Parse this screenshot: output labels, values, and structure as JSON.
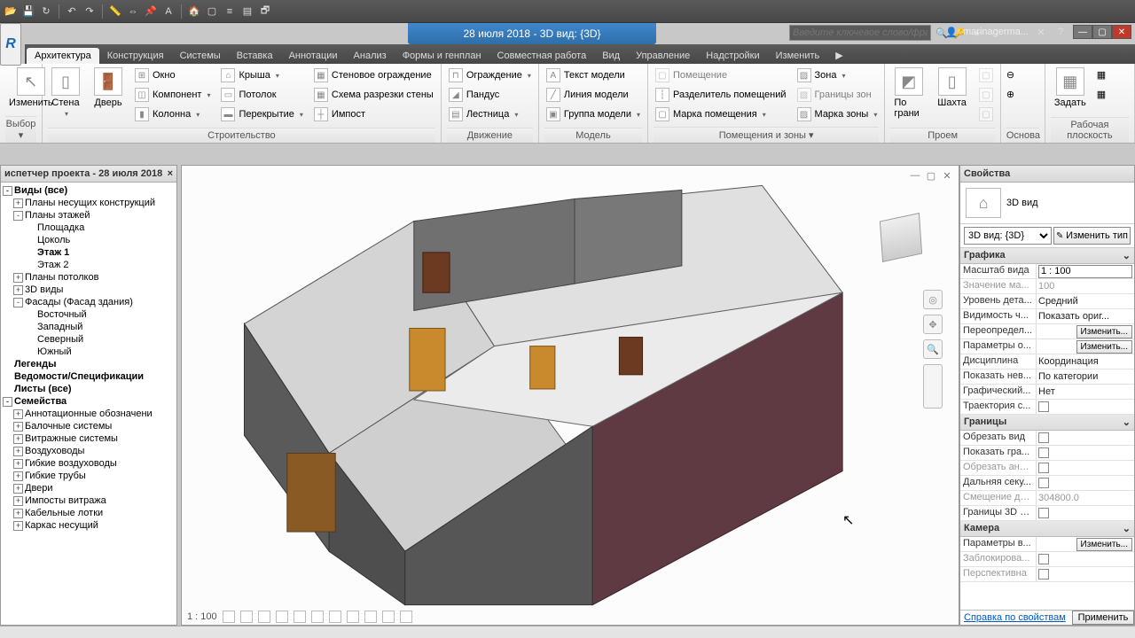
{
  "title": "28 июля 2018 - 3D вид: {3D}",
  "search_placeholder": "Введите ключевое слово/фразу",
  "user": "marinagerma...",
  "tabs": [
    "Архитектура",
    "Конструкция",
    "Системы",
    "Вставка",
    "Аннотации",
    "Анализ",
    "Формы и генплан",
    "Совместная работа",
    "Вид",
    "Управление",
    "Надстройки",
    "Изменить"
  ],
  "active_tab": 0,
  "ribbon": {
    "select": {
      "modify": "Изменить",
      "group": "Выбор"
    },
    "build": {
      "wall": "Стена",
      "door": "Дверь",
      "window": "Окно",
      "component": "Компонент",
      "column": "Колонна",
      "roof": "Крыша",
      "ceiling": "Потолок",
      "floor": "Перекрытие",
      "curtain_wall": "Стеновое ограждение",
      "curtain_grid": "Схема разрезки стены",
      "mullion": "Импост",
      "group": "Строительство"
    },
    "circ": {
      "rail": "Ограждение",
      "ramp": "Пандус",
      "stair": "Лестница",
      "group": "Движение"
    },
    "model": {
      "text": "Текст модели",
      "line": "Линия модели",
      "grp": "Группа модели",
      "group": "Модель"
    },
    "rooms": {
      "room": "Помещение",
      "room_sep": "Разделитель помещений",
      "room_tag": "Марка помещения",
      "area": "Зона",
      "area_bound": "Границы зон",
      "area_tag": "Марка зоны",
      "group": "Помещения и зоны"
    },
    "opening": {
      "face": "По грани",
      "shaft": "Шахта",
      "group": "Проем"
    },
    "datum": {
      "grid": "",
      "group": "Основа"
    },
    "work": {
      "set": "Задать",
      "group": "Рабочая плоскость"
    }
  },
  "browser": {
    "title": "испетчер проекта - 28 июля 2018",
    "nodes": [
      {
        "lvl": 0,
        "pm": "-",
        "bold": true,
        "label": "Виды (все)"
      },
      {
        "lvl": 1,
        "pm": "+",
        "label": "Планы несущих конструкций"
      },
      {
        "lvl": 1,
        "pm": "-",
        "label": "Планы этажей"
      },
      {
        "lvl": 2,
        "label": "Площадка"
      },
      {
        "lvl": 2,
        "label": "Цоколь"
      },
      {
        "lvl": 2,
        "bold": true,
        "label": "Этаж 1"
      },
      {
        "lvl": 2,
        "label": "Этаж 2"
      },
      {
        "lvl": 1,
        "pm": "+",
        "label": "Планы потолков"
      },
      {
        "lvl": 1,
        "pm": "+",
        "label": "3D виды"
      },
      {
        "lvl": 1,
        "pm": "-",
        "label": "Фасады (Фасад здания)"
      },
      {
        "lvl": 2,
        "label": "Восточный"
      },
      {
        "lvl": 2,
        "label": "Западный"
      },
      {
        "lvl": 2,
        "label": "Северный"
      },
      {
        "lvl": 2,
        "label": "Южный"
      },
      {
        "lvl": 0,
        "bold": true,
        "label": "Легенды"
      },
      {
        "lvl": 0,
        "bold": true,
        "label": "Ведомости/Спецификации"
      },
      {
        "lvl": 0,
        "bold": true,
        "label": "Листы (все)"
      },
      {
        "lvl": 0,
        "pm": "-",
        "bold": true,
        "label": "Семейства"
      },
      {
        "lvl": 1,
        "pm": "+",
        "label": "Аннотационные обозначени"
      },
      {
        "lvl": 1,
        "pm": "+",
        "label": "Балочные системы"
      },
      {
        "lvl": 1,
        "pm": "+",
        "label": "Витражные системы"
      },
      {
        "lvl": 1,
        "pm": "+",
        "label": "Воздуховоды"
      },
      {
        "lvl": 1,
        "pm": "+",
        "label": "Гибкие воздуховоды"
      },
      {
        "lvl": 1,
        "pm": "+",
        "label": "Гибкие трубы"
      },
      {
        "lvl": 1,
        "pm": "+",
        "label": "Двери"
      },
      {
        "lvl": 1,
        "pm": "+",
        "label": "Импосты витража"
      },
      {
        "lvl": 1,
        "pm": "+",
        "label": "Кабельные лотки"
      },
      {
        "lvl": 1,
        "pm": "+",
        "label": "Каркас несущий"
      }
    ]
  },
  "view_scale": "1 : 100",
  "props": {
    "title": "Свойства",
    "type_name": "3D вид",
    "selector": "3D вид: {3D}",
    "edit_type": "Изменить тип",
    "cats": [
      {
        "name": "Графика",
        "rows": [
          {
            "k": "Масштаб вида",
            "v": "1 : 100",
            "input": true
          },
          {
            "k": "Значение ма...",
            "v": "100",
            "dim": true
          },
          {
            "k": "Уровень дета...",
            "v": "Средний"
          },
          {
            "k": "Видимость ч...",
            "v": "Показать ориг..."
          },
          {
            "k": "Переопредел...",
            "btn": "Изменить..."
          },
          {
            "k": "Параметры о...",
            "btn": "Изменить..."
          },
          {
            "k": "Дисциплина",
            "v": "Координация"
          },
          {
            "k": "Показать нев...",
            "v": "По категории"
          },
          {
            "k": "Графический...",
            "v": "Нет"
          },
          {
            "k": "Траектория с...",
            "chk": true
          }
        ]
      },
      {
        "name": "Границы",
        "rows": [
          {
            "k": "Обрезать вид",
            "chk": true
          },
          {
            "k": "Показать гра...",
            "chk": true
          },
          {
            "k": "Обрезать анн...",
            "chk": true,
            "dim": true
          },
          {
            "k": "Дальняя секу...",
            "chk": true
          },
          {
            "k": "Смещение да...",
            "v": "304800.0",
            "dim": true
          },
          {
            "k": "Границы 3D в...",
            "chk": true
          }
        ]
      },
      {
        "name": "Камера",
        "rows": [
          {
            "k": "Параметры в...",
            "btn": "Изменить..."
          },
          {
            "k": "Заблокирова...",
            "chk": true,
            "dim": true
          },
          {
            "k": "Перспективна",
            "chk": true,
            "dim": true
          }
        ]
      }
    ],
    "help": "Справка по свойствам",
    "apply": "Применить"
  }
}
